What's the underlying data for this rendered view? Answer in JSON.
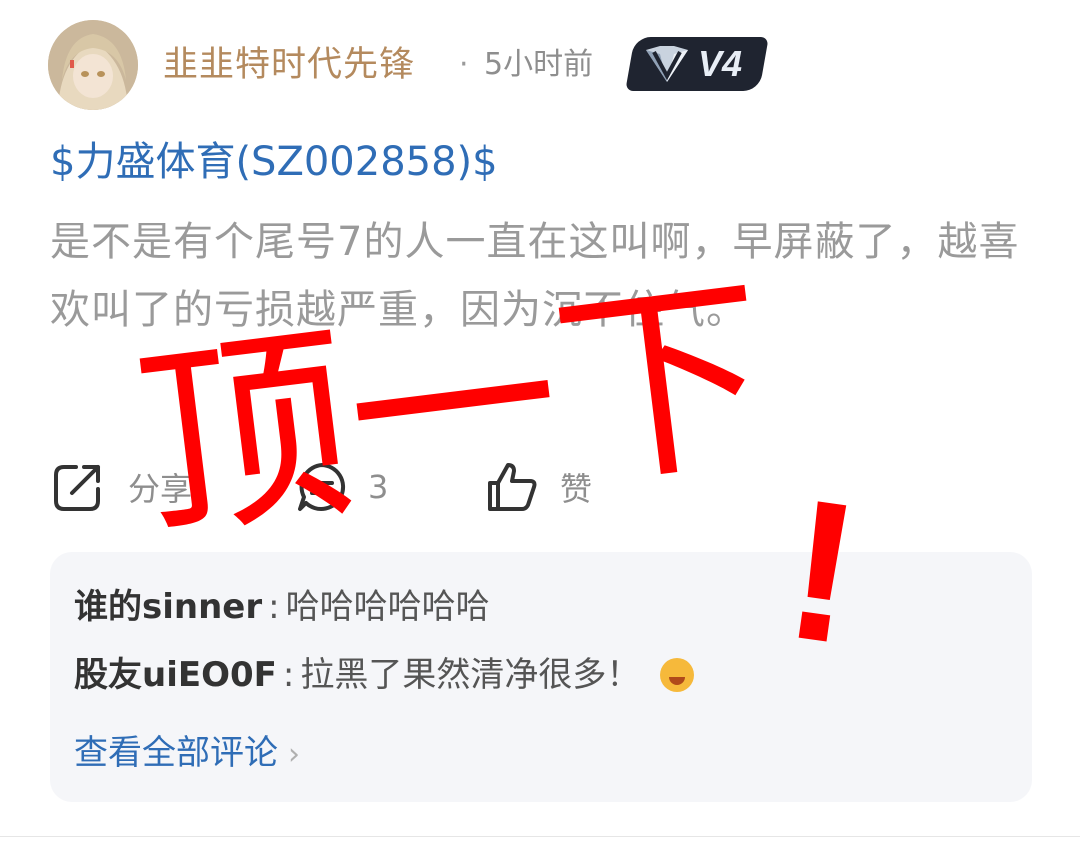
{
  "post": {
    "username": "韭韭特时代先锋",
    "separator": "·",
    "time": "5小时前",
    "level_badge": "V4",
    "stock_tag": "$力盛体育(SZ002858)$",
    "body": "是不是有个尾号7的人一直在这叫啊，早屏蔽了，越喜欢叫了的亏损越严重，因为沉不住气。"
  },
  "actions": {
    "share_label": "分享",
    "comment_count": "3",
    "like_label": "赞"
  },
  "comments": [
    {
      "user": "谁的sinner",
      "colon": ":",
      "text": "哈哈哈哈哈哈"
    },
    {
      "user": "股友uiEO0F",
      "colon": ":",
      "text": "拉黑了果然清净很多！"
    }
  ],
  "view_all_label": "查看全部评论",
  "overlay_text": {
    "line1": "顶一下",
    "line2": "!"
  },
  "colors": {
    "username": "#b48a5e",
    "stock_link": "#2f6db6",
    "overlay_red": "#ff0000",
    "comment_bg": "#f5f6f9"
  }
}
